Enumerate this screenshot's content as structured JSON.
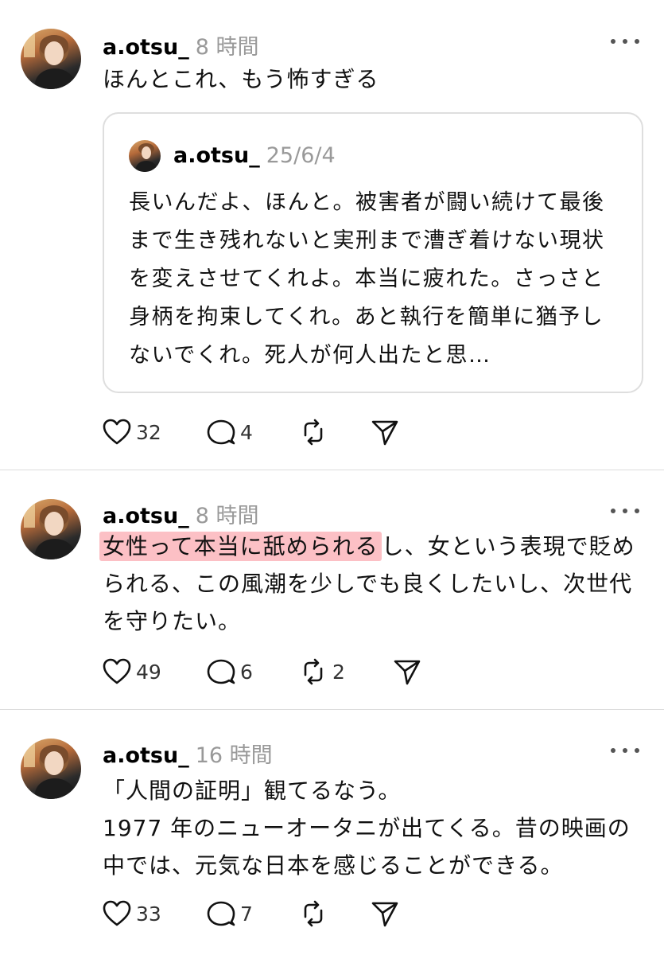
{
  "posts": [
    {
      "username": "a.otsu_",
      "time": "8 時間",
      "text_lines": [
        "ほんとこれ、もう怖すぎる"
      ],
      "quote": {
        "username": "a.otsu_",
        "time": "25/6/4",
        "text": "長いんだよ、ほんと。被害者が闘い続けて最後まで生き残れないと実刑まで漕ぎ着けない現状を変えさせてくれよ。本当に疲れた。さっさと身柄を拘束してくれ。あと執行を簡単に猶予しないでくれ。死人が何人出たと思…"
      },
      "likes": "32",
      "replies": "4",
      "reposts": "",
      "icons": [
        "heart-icon",
        "comment-icon",
        "repost-icon",
        "share-icon",
        "more-icon"
      ]
    },
    {
      "username": "a.otsu_",
      "time": "8 時間",
      "text_highlight": "女性って本当に舐められる",
      "text_rest": "し、女という表現で貶められる、この風潮を少しでも良くしたいし、次世代を守りたい。",
      "likes": "49",
      "replies": "6",
      "reposts": "2",
      "highlight_color": "#f88c96"
    },
    {
      "username": "a.otsu_",
      "time": "16 時間",
      "paragraphs": [
        "「人間の証明」観てるなう。",
        "1977 年のニューオータニが出てくる。昔の映画の中では、元気な日本を感じることができる。"
      ],
      "likes": "33",
      "replies": "7",
      "reposts": ""
    }
  ]
}
